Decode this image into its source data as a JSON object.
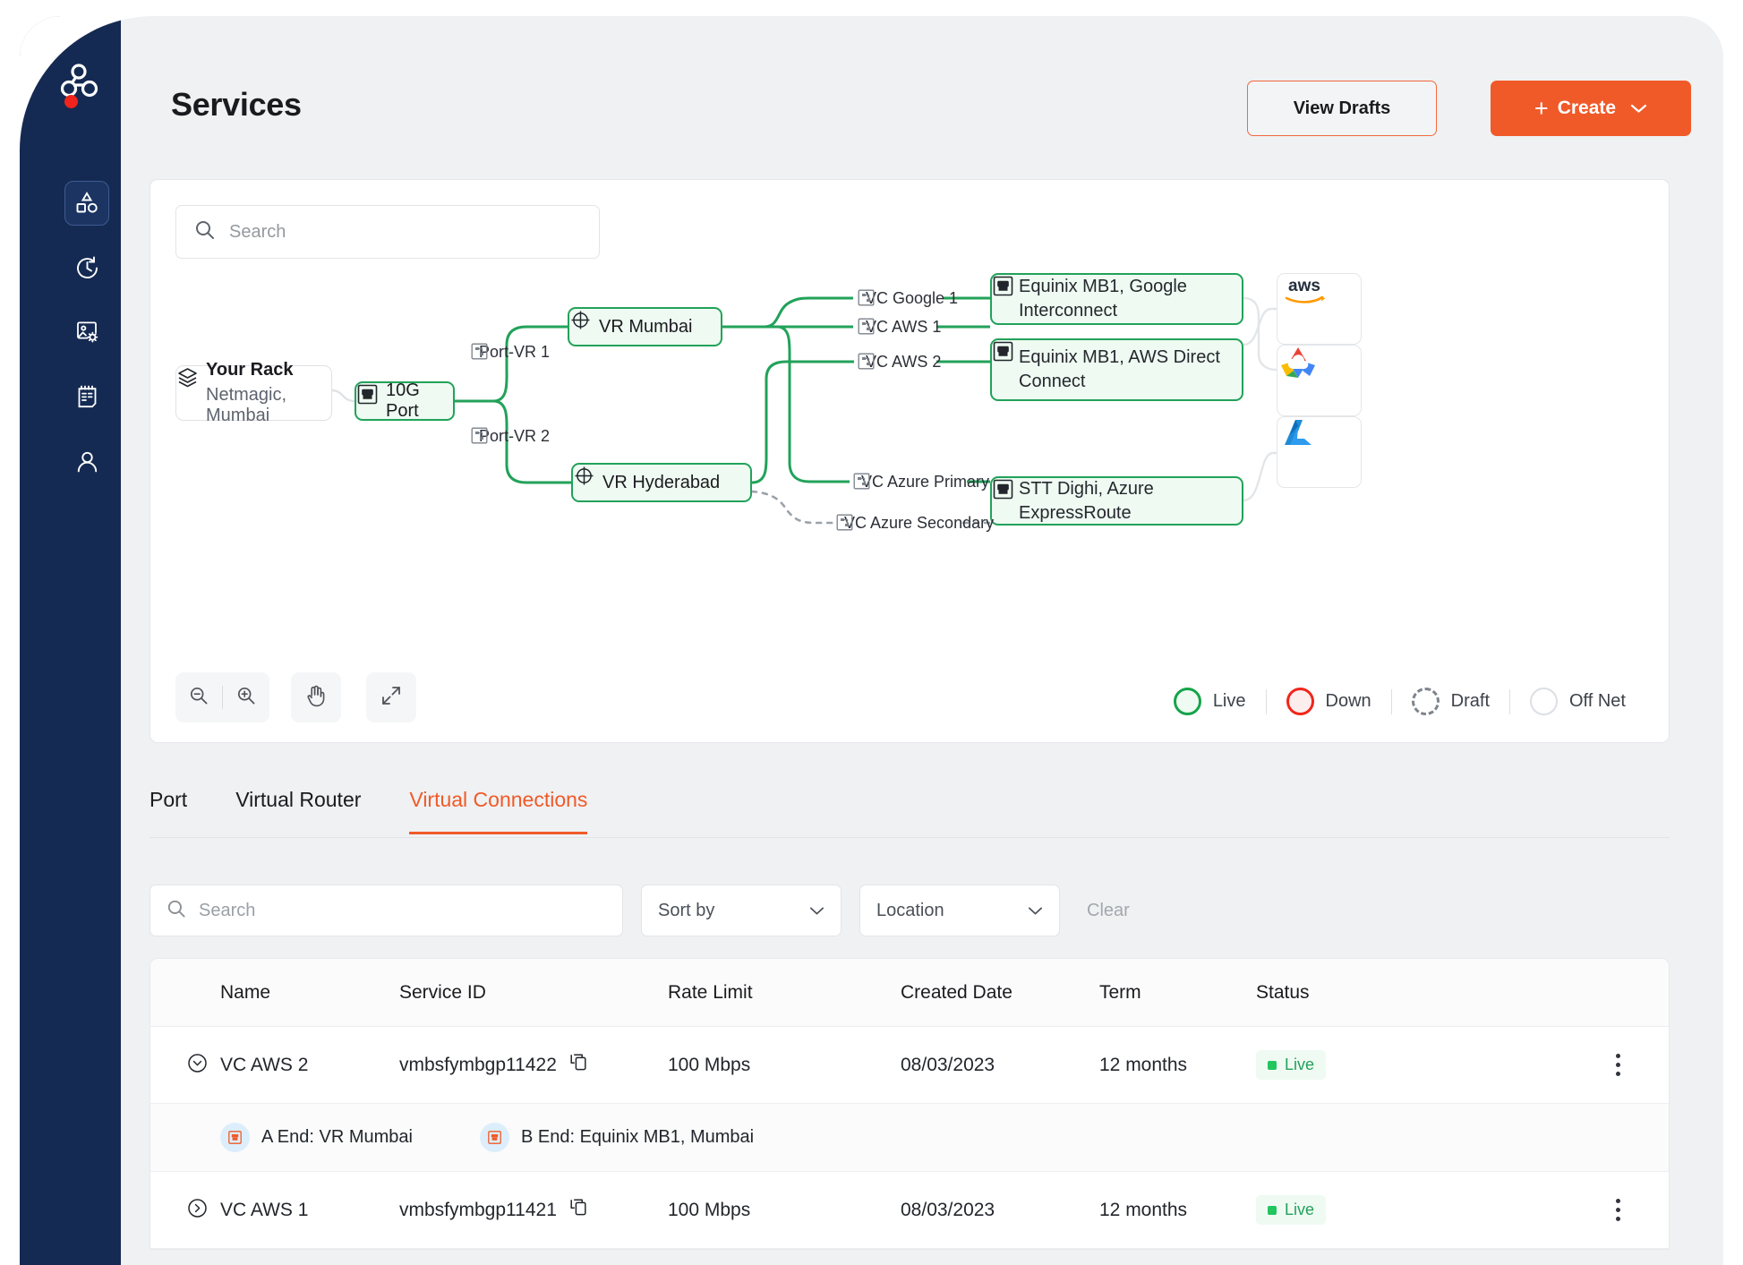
{
  "colors": {
    "brand_orange": "#f05a28",
    "sidebar_navy": "#152a52",
    "live_green": "#22a25a",
    "down_red": "#f1261c",
    "page_bg": "#eff1f3"
  },
  "sidebar": {
    "logo_name": "network-logo",
    "items": [
      {
        "name": "sidebar-item-services",
        "icon": "shapes-icon",
        "active": true
      },
      {
        "name": "sidebar-item-history",
        "icon": "history-clock-icon",
        "active": false
      },
      {
        "name": "sidebar-item-image-settings",
        "icon": "image-settings-icon",
        "active": false
      },
      {
        "name": "sidebar-item-notes",
        "icon": "notepad-icon",
        "active": false
      },
      {
        "name": "sidebar-item-account",
        "icon": "user-icon",
        "active": false
      }
    ]
  },
  "header": {
    "title": "Services",
    "view_drafts_label": "View Drafts",
    "create_label": "Create",
    "create_plus": "+",
    "create_chevron": "chevron-down-icon"
  },
  "diagram": {
    "search_placeholder": "Search",
    "nodes": {
      "rack": {
        "title": "Your Rack",
        "subtitle": "Netmagic, Mumbai"
      },
      "port": {
        "label": "10G Port"
      },
      "vr_mumbai": {
        "label": "VR Mumbai"
      },
      "vr_hyderabad": {
        "label": "VR Hyderabad"
      },
      "equinix_google": {
        "label": "Equinix MB1, Google Interconnect"
      },
      "equinix_aws": {
        "label": "Equinix MB1, AWS Direct Connect"
      },
      "stt_azure": {
        "label": "STT Dighi, Azure ExpressRoute"
      }
    },
    "edge_labels": {
      "port_vr_1": "Port-VR 1",
      "port_vr_2": "Port-VR 2",
      "vc_google_1": "VC Google 1",
      "vc_aws_1": "VC AWS 1",
      "vc_aws_2": "VC AWS 2",
      "vc_azure_primary": "VC Azure Primary",
      "vc_azure_secondary": "VC Azure Secondary"
    },
    "clouds": [
      {
        "name": "aws-logo",
        "label": "aws"
      },
      {
        "name": "google-cloud-logo",
        "label": "Google Cloud"
      },
      {
        "name": "azure-logo",
        "label": "Azure"
      }
    ],
    "toolbar": [
      {
        "name": "zoom-out-button",
        "icon": "zoom-out-icon"
      },
      {
        "name": "zoom-in-button",
        "icon": "zoom-in-icon"
      },
      {
        "name": "pan-tool-button",
        "icon": "hand-icon"
      },
      {
        "name": "fullscreen-button",
        "icon": "expand-icon"
      }
    ],
    "legend": [
      {
        "label": "Live",
        "state": "live"
      },
      {
        "label": "Down",
        "state": "down"
      },
      {
        "label": "Draft",
        "state": "draft"
      },
      {
        "label": "Off Net",
        "state": "offnet"
      }
    ]
  },
  "tabs": [
    {
      "label": "Port",
      "active": false
    },
    {
      "label": "Virtual Router",
      "active": false
    },
    {
      "label": "Virtual Connections",
      "active": true
    }
  ],
  "filters": {
    "search_placeholder": "Search",
    "sort_by_label": "Sort by",
    "location_label": "Location",
    "clear_label": "Clear"
  },
  "table": {
    "columns": [
      "Name",
      "Service ID",
      "Rate Limit",
      "Created Date",
      "Term",
      "Status"
    ],
    "rows": [
      {
        "expanded": true,
        "name": "VC AWS 2",
        "service_id": "vmbsfymbgp11422",
        "rate_limit": "100 Mbps",
        "created_date": "08/03/2023",
        "term": "12 months",
        "status": "Live",
        "a_end": "A End: VR Mumbai",
        "b_end": "B End: Equinix MB1, Mumbai"
      },
      {
        "expanded": false,
        "name": "VC AWS 1",
        "service_id": "vmbsfymbgp11421",
        "rate_limit": "100 Mbps",
        "created_date": "08/03/2023",
        "term": "12 months",
        "status": "Live"
      }
    ]
  }
}
